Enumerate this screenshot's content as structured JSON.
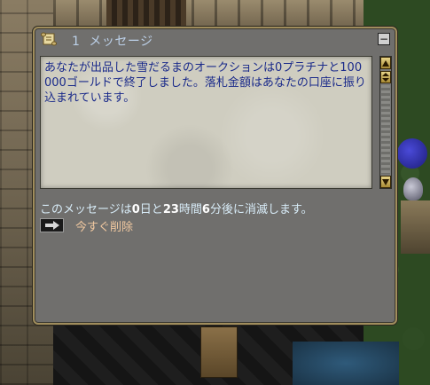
{
  "gump": {
    "title_count": "1",
    "title": "メッセージ",
    "minimize_label": "−",
    "message": "あなたが出品した雪だるまのオークションは0プラチナと100000ゴールドで終了しました。落札金額はあなたの口座に振り込まれています。",
    "expiry": {
      "prefix": "このメッセージは",
      "days": "0",
      "days_unit": "日と",
      "hours": "23",
      "hours_unit": "時間",
      "minutes": "6",
      "suffix": "分後に消滅します。"
    },
    "delete_label": "今すぐ削除"
  },
  "colors": {
    "panel_bg": "#706f6d",
    "border_gold": "#a08d5c",
    "title_text": "#bcd0e8",
    "message_text": "#1a2a8a",
    "expiry_text": "#d8ecf8",
    "delete_text": "#f0c8a0"
  },
  "icons": {
    "title": "scroll-icon",
    "minimize": "minimize-icon",
    "scroll_up": "arrow-up-icon",
    "scroll_thumb": "updown-icon",
    "scroll_down": "arrow-down-icon",
    "delete": "arrow-right-icon"
  }
}
